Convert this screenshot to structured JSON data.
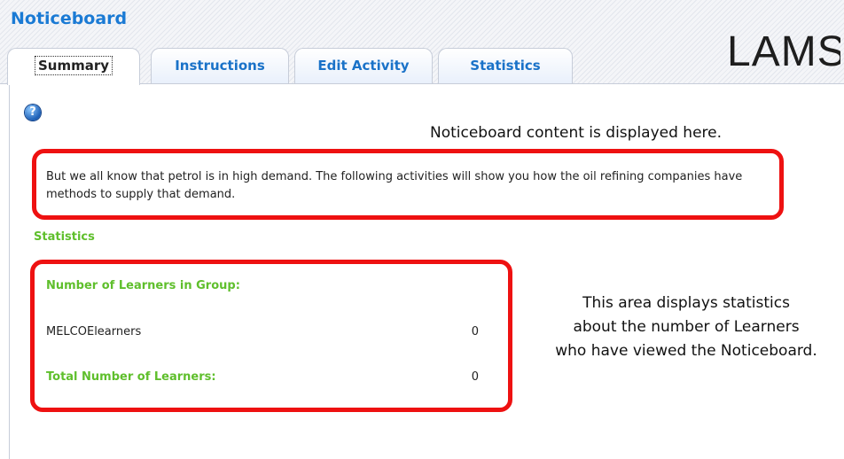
{
  "app": {
    "title": "Noticeboard",
    "logo_text": "LAMS"
  },
  "tabs": [
    {
      "label": "Summary",
      "active": true
    },
    {
      "label": "Instructions",
      "active": false
    },
    {
      "label": "Edit Activity",
      "active": false
    },
    {
      "label": "Statistics",
      "active": false
    }
  ],
  "help": {
    "icon": "help-icon",
    "glyph": "?"
  },
  "annotations": {
    "content_callout": "Noticeboard content is displayed here.",
    "stats_callout_lines": [
      "This area displays statistics",
      "about the number of Learners",
      "who have viewed the Noticeboard."
    ]
  },
  "noticeboard": {
    "content": "But we all know that petrol is in high demand. The following activities will show you how the oil refining companies have methods to supply that demand."
  },
  "statistics": {
    "heading": "Statistics",
    "group_heading": "Number of Learners in Group:",
    "groups": [
      {
        "name": "MELCOElearners",
        "count": "0"
      }
    ],
    "total_label": "Total Number of Learners:",
    "total_value": "0"
  },
  "colors": {
    "brand_blue": "#1a7ad4",
    "statistics_green": "#5fbf2c",
    "annotation_red": "#ee1111"
  }
}
